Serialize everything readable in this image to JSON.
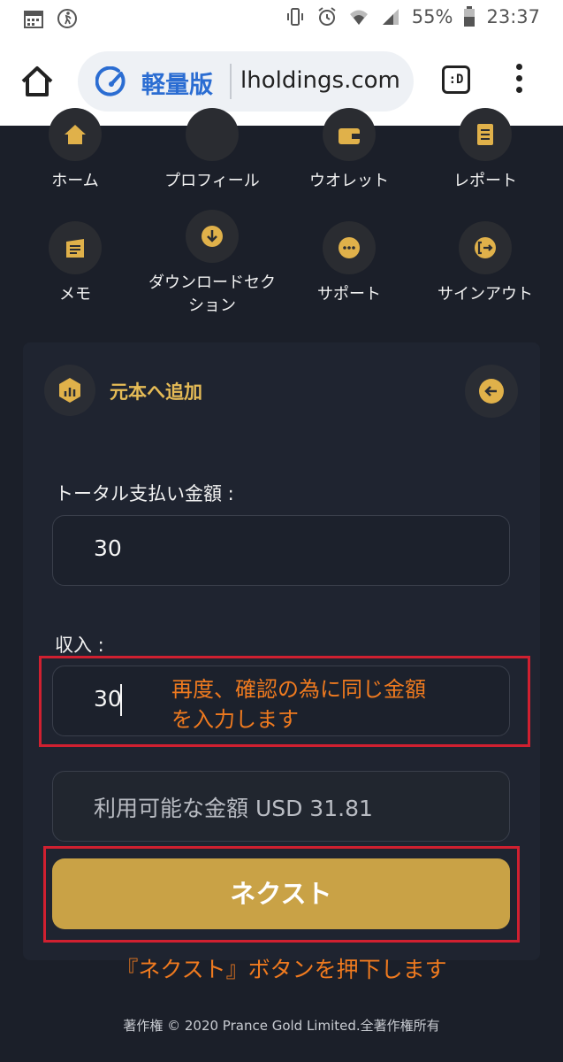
{
  "status_bar": {
    "battery": "55%",
    "time": "23:37"
  },
  "browser": {
    "lite_label": "軽量版",
    "url": "lholdings.com",
    "tabs_label": ":D"
  },
  "nav": {
    "items": [
      {
        "label": "ホーム",
        "icon": "home-icon"
      },
      {
        "label": "プロフィール",
        "icon": "profile-icon"
      },
      {
        "label": "ウオレット",
        "icon": "wallet-icon"
      },
      {
        "label": "レポート",
        "icon": "report-icon"
      },
      {
        "label": "メモ",
        "icon": "memo-icon"
      },
      {
        "label": "ダウンロードセクション",
        "label_line1": "ダウンロードセク",
        "label_line2": "ション",
        "icon": "download-icon"
      },
      {
        "label": "サポート",
        "icon": "support-icon"
      },
      {
        "label": "サインアウト",
        "icon": "signout-icon"
      }
    ]
  },
  "card": {
    "title": "元本へ追加",
    "total_label": "トータル支払い金額 :",
    "total_value": "30",
    "income_label": "収入 :",
    "income_value": "30",
    "available_text": "利用可能な金額 USD 31.81",
    "next_button": "ネクスト"
  },
  "annotations": {
    "income_note_line1": "再度、確認の為に同じ金額",
    "income_note_line2": "を入力します",
    "next_note": "『ネクスト』ボタンを押下します"
  },
  "footer": "著作権 © 2020 Prance Gold Limited.全著作権所有",
  "colors": {
    "accent": "#c9a246",
    "icon_gold": "#e0b14a",
    "annotation": "#ef7a1f",
    "annotation_box": "#d02030",
    "background": "#1b1f29",
    "card": "#1f2430"
  }
}
